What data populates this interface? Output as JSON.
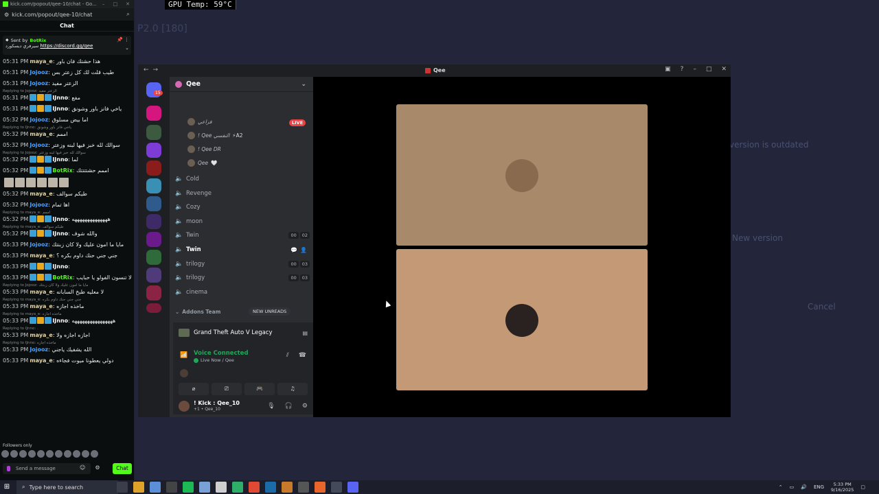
{
  "desktop": {
    "gpu_temp": "GPU Temp: 59°C",
    "ghost_title": "P2.0 [180]",
    "ghost_texts": [
      "version is outdated",
      "New version",
      "Cancel"
    ]
  },
  "chat": {
    "window_title": "kick.com/popout/qee-10/chat - Go...",
    "url": "kick.com/popout/qee-10/chat",
    "header": "Chat",
    "pinned": {
      "sent_by": "Sent by",
      "bot": "BotRix",
      "text": "سيرفري ديسكورد",
      "link": "https://discord.gg/qee"
    },
    "messages": [
      {
        "time": "05:31 PM",
        "user": "maya_e",
        "color": "#e3d4a6",
        "text": ": هذا حشتك فان باور",
        "reply": ""
      },
      {
        "time": "05:31 PM",
        "user": "Jojooz",
        "color": "#4aa0ff",
        "text": ": طيب قلت لك كل زعتر بس",
        "reply": ""
      },
      {
        "time": "05:31 PM",
        "user": "Jojooz",
        "color": "#4aa0ff",
        "text": ": الزعتر مفيد",
        "reply": ""
      },
      {
        "time": "05:31 PM",
        "user": "IJnno",
        "color": "#ffffff",
        "text": ": مفع",
        "reply": "Replying to Jojooz: الزعتر مفيد",
        "badges": true
      },
      {
        "time": "05:31 PM",
        "user": "IJnno",
        "color": "#ffffff",
        "text": ": ياخي فانز باور وشونق",
        "reply": "",
        "badges": true
      },
      {
        "time": "05:32 PM",
        "user": "Jojooz",
        "color": "#4aa0ff",
        "text": ": اما بيض مسلوق",
        "reply": ""
      },
      {
        "time": "05:32 PM",
        "user": "maya_e",
        "color": "#e3d4a6",
        "text": ": اممم",
        "reply": "Replying to IJnno: ياخي فانز باور وشونق"
      },
      {
        "time": "05:32 PM",
        "user": "Jojooz",
        "color": "#4aa0ff",
        "text": ": سوالك لله خبز فيها لبنه وزعتر",
        "reply": ""
      },
      {
        "time": "05:32 PM",
        "user": "IJnno",
        "color": "#ffffff",
        "text": ": لما",
        "reply": "Replying to Jojooz: سوالك لله خبز فيها لبنه وزعتر",
        "badges": true
      },
      {
        "time": "05:32 PM",
        "user": "BotRix",
        "color": "#53fc18",
        "text": ": اممم حشتتتتك",
        "reply": "",
        "badges": true,
        "emoterow": true
      },
      {
        "time": "05:32 PM",
        "user": "maya_e",
        "color": "#e3d4a6",
        "text": ": طيكم سوالف",
        "reply": ""
      },
      {
        "time": "05:32 PM",
        "user": "Jojooz",
        "color": "#4aa0ff",
        "text": ": اها تمام",
        "reply": ""
      },
      {
        "time": "05:32 PM",
        "user": "IJnno",
        "color": "#ffffff",
        "text": ": ههههههههههههههه",
        "reply": "Replying to maya_e: اممم",
        "badges": true
      },
      {
        "time": "05:32 PM",
        "user": "IJnno",
        "color": "#ffffff",
        "text": ": والله شوف",
        "reply": "Replying to maya_e: طيكم سوالف",
        "badges": true
      },
      {
        "time": "05:33 PM",
        "user": "Jojooz",
        "color": "#4aa0ff",
        "text": ": مايا ما امون عليك ولا كان زبنتك",
        "reply": ""
      },
      {
        "time": "05:33 PM",
        "user": "maya_e",
        "color": "#e3d4a6",
        "text": ": جني جني حنك داوم بكره ؟",
        "reply": ""
      },
      {
        "time": "05:33 PM",
        "user": "IJnno",
        "color": "#ffffff",
        "text": ":",
        "reply": "",
        "badges": true
      },
      {
        "time": "05:33 PM",
        "user": "BotRix",
        "color": "#53fc18",
        "text": ": لا تنسون الفولو يا حبايب",
        "reply": "",
        "badges": true
      },
      {
        "time": "05:33 PM",
        "user": "maya_e",
        "color": "#e3d4a6",
        "text": ": لا معليه طبخ السابانه",
        "reply": "Replying to Jojooz: مايا ما امون عليك ولا كان زبنتك"
      },
      {
        "time": "05:33 PM",
        "user": "maya_e",
        "color": "#e3d4a6",
        "text": ": ماخذه اجازه",
        "reply": "Replying to maya_e: جني جني حنك داوم بكره"
      },
      {
        "time": "05:33 PM",
        "user": "IJnno",
        "color": "#ffffff",
        "text": ": ههههههههههههههههه",
        "reply": "Replying to maya_e: ماخذه اجازه",
        "badges": true
      },
      {
        "time": "05:33 PM",
        "user": "maya_e",
        "color": "#e3d4a6",
        "text": ": اجازه اجازه ولا",
        "reply": "Replying to IJnno: ."
      },
      {
        "time": "05:33 PM",
        "user": "Jojooz",
        "color": "#4aa0ff",
        "text": ": الله يشفيك ياجني",
        "reply": "Replying to IJnno: ماخذه اجازه"
      },
      {
        "time": "05:33 PM",
        "user": "maya_e",
        "color": "#e3d4a6",
        "text": ": دولي يعطونا ميوت فجاءه",
        "reply": ""
      }
    ],
    "followers_only": "Followers only",
    "input_placeholder": "Send a message",
    "send_label": "Chat"
  },
  "discord": {
    "title": "Qee",
    "server_name": "Qee",
    "guild_badge": "15",
    "live_label": "LIVE",
    "members": [
      {
        "name": "فزاعي",
        "tag": ""
      },
      {
        "name": "! Qee النفسي",
        "tag": "⚡A2"
      },
      {
        "name": "! Qee DR",
        "tag": ""
      },
      {
        "name": "Qee",
        "tag": "🤍"
      }
    ],
    "channels": [
      {
        "name": "Cold",
        "counts": []
      },
      {
        "name": "Revenge",
        "counts": []
      },
      {
        "name": "Cozy",
        "counts": []
      },
      {
        "name": "moon",
        "counts": []
      },
      {
        "name": "Twin",
        "counts": [
          "00",
          "02"
        ]
      },
      {
        "name": "Twin",
        "counts": [],
        "active": true
      },
      {
        "name": "trilogy",
        "counts": [
          "00",
          "03"
        ]
      },
      {
        "name": "trilogy",
        "counts": [
          "00",
          "03"
        ]
      },
      {
        "name": "cinema",
        "counts": []
      }
    ],
    "category": "Addons Team",
    "new_unreads": "NEW UNREADS",
    "activity": "Grand Theft Auto V Legacy",
    "voice_status": "Voice Connected",
    "voice_sub": "Live Now / Qee",
    "user_name": "! Kick : Qee_10",
    "user_sub": "+1 • Qee_10"
  },
  "taskbar": {
    "search_placeholder": "Type here to search",
    "lang": "ENG",
    "time": "5:33 PM",
    "date": "9/16/2025"
  },
  "colors": {
    "kick_green": "#53fc18",
    "discord_green": "#23a55a",
    "live_red": "#ed4245",
    "tile_top": "#a88a6a",
    "tile_bottom": "#c49a76"
  }
}
